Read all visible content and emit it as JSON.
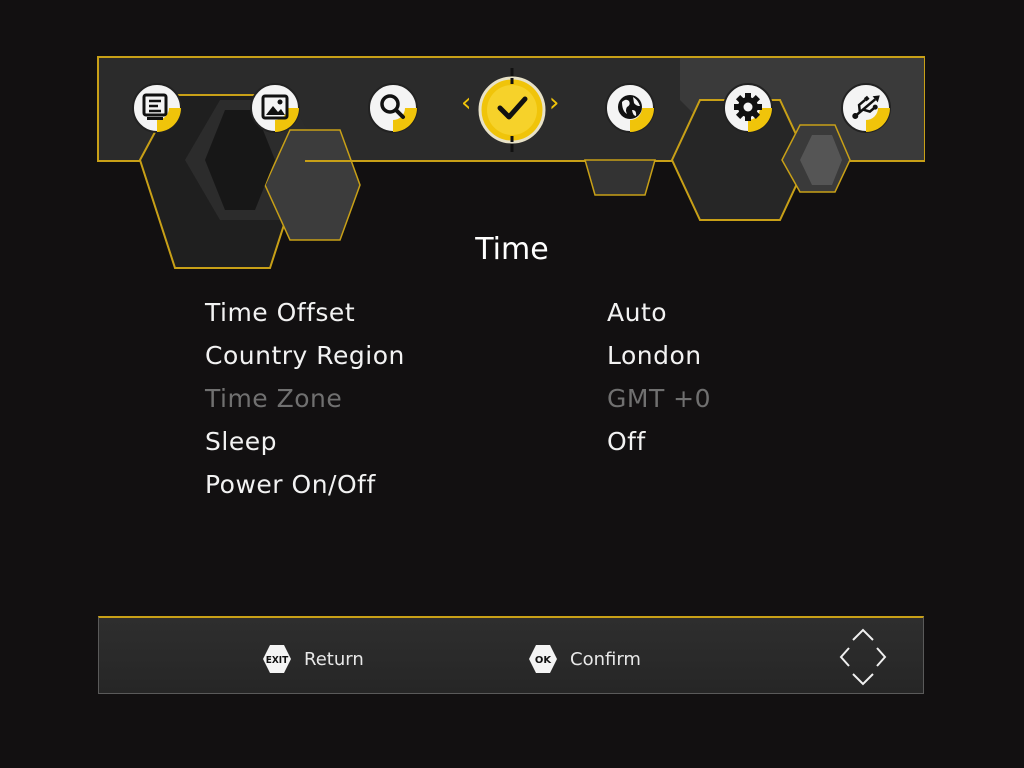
{
  "top_menu": {
    "items": [
      {
        "name": "program",
        "icon": "program-list-icon"
      },
      {
        "name": "picture",
        "icon": "picture-icon"
      },
      {
        "name": "search",
        "icon": "search-icon"
      },
      {
        "name": "time",
        "icon": "clock-check-icon",
        "selected": true
      },
      {
        "name": "language",
        "icon": "globe-icon"
      },
      {
        "name": "settings",
        "icon": "gear-icon"
      },
      {
        "name": "usb",
        "icon": "usb-icon"
      }
    ],
    "prev_arrow": "‹",
    "next_arrow": "›"
  },
  "page": {
    "title": "Time"
  },
  "settings": {
    "rows": [
      {
        "label": "Time Offset",
        "value": "Auto",
        "enabled": true
      },
      {
        "label": "Country Region",
        "value": "London",
        "enabled": true
      },
      {
        "label": "Time Zone",
        "value": "GMT +0",
        "enabled": false
      },
      {
        "label": "Sleep",
        "value": "Off",
        "enabled": true
      },
      {
        "label": "Power On/Off",
        "value": "",
        "enabled": true
      }
    ]
  },
  "footer": {
    "exit_badge": "EXIT",
    "exit_label": "Return",
    "ok_badge": "OK",
    "ok_label": "Confirm",
    "nav_icon": "direction-pad-icon"
  },
  "colors": {
    "accent": "#f0c40a",
    "background": "#121011",
    "panel": "#2a2a2a",
    "disabled_text": "#707070"
  }
}
